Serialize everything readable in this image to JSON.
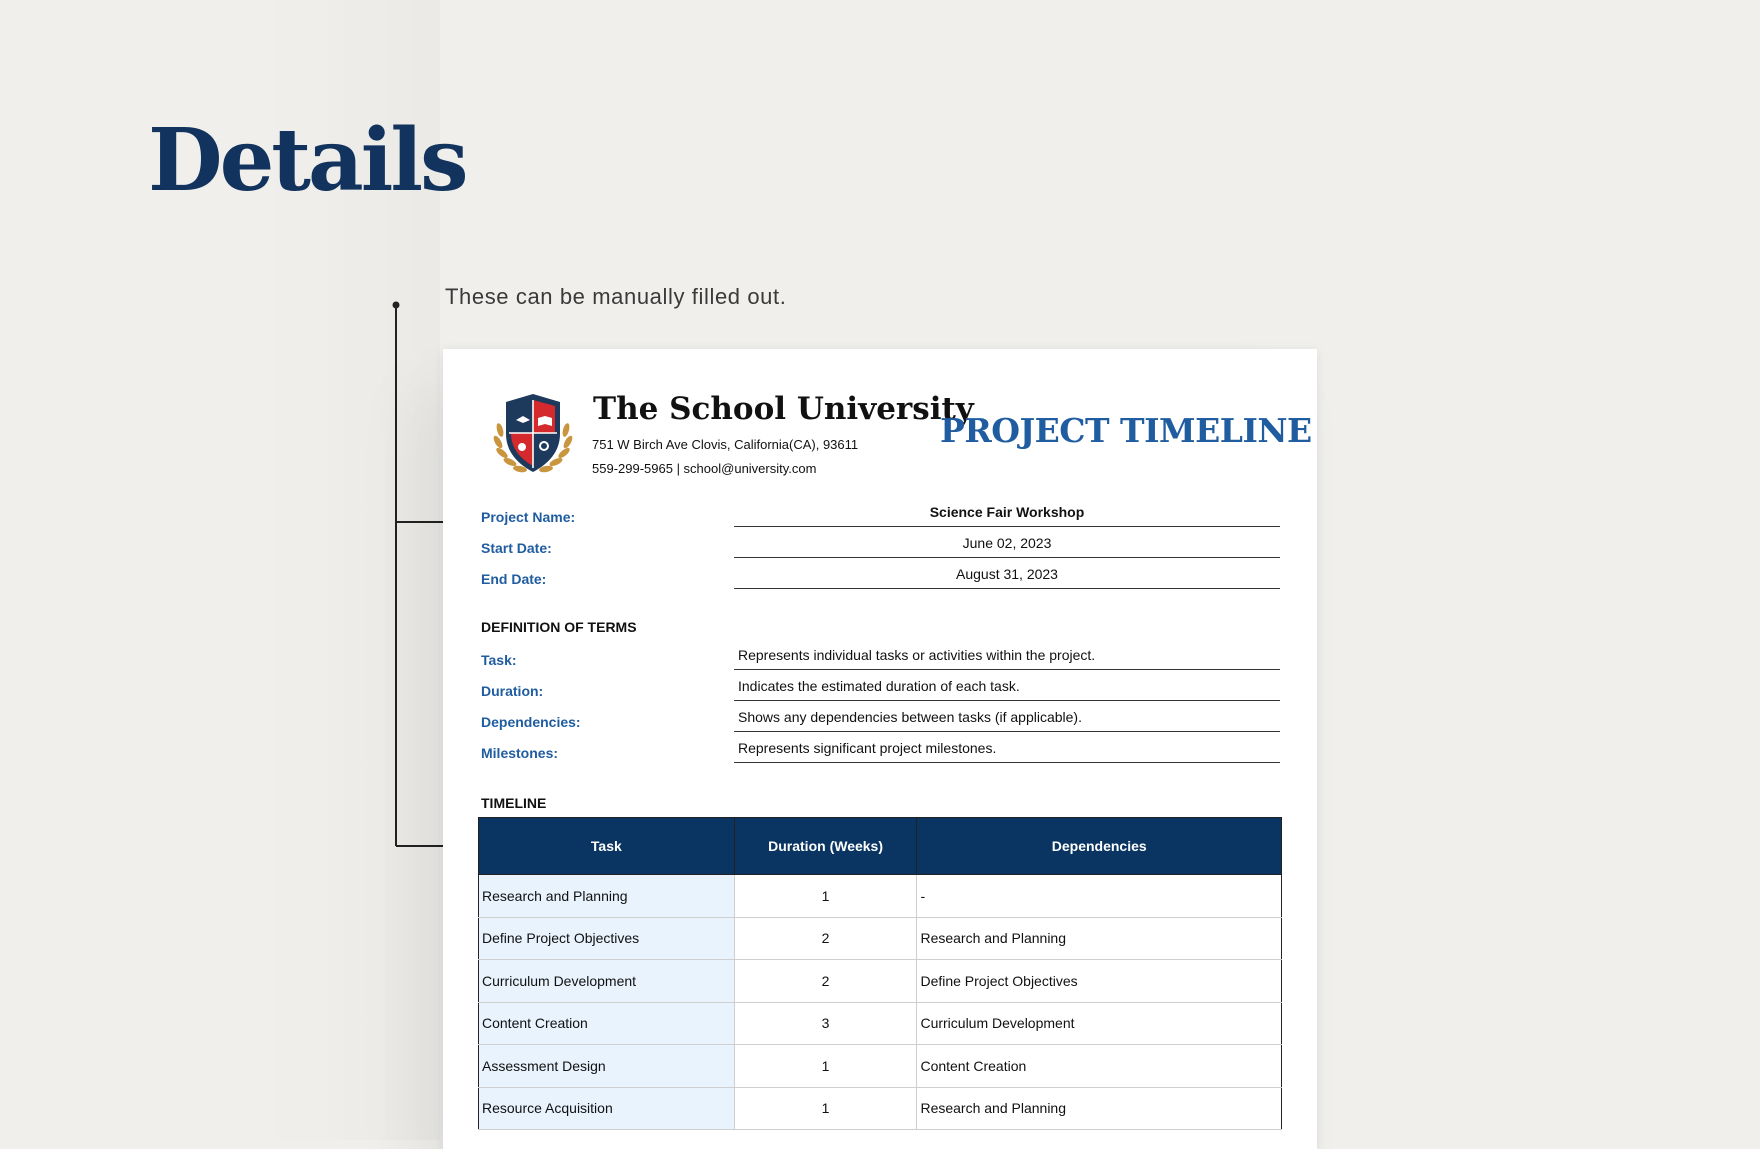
{
  "page": {
    "heading": "Details",
    "caption": "These can be manually filled out."
  },
  "document": {
    "school_name": "The School University",
    "address": "751 W Birch Ave Clovis, California(CA), 93611",
    "contact": "559-299-5965 | school@university.com",
    "title": "PROJECT TIMELINE",
    "details": [
      {
        "label": "Project Name:",
        "value": "Science Fair Workshop"
      },
      {
        "label": "Start Date:",
        "value": "June 02, 2023"
      },
      {
        "label": "End Date:",
        "value": "August 31, 2023"
      }
    ],
    "definitions_title": "DEFINITION OF TERMS",
    "definitions": [
      {
        "label": "Task:",
        "value": "Represents individual tasks or activities within the project."
      },
      {
        "label": "Duration:",
        "value": "Indicates the estimated duration of each task."
      },
      {
        "label": "Dependencies:",
        "value": "Shows any dependencies between tasks (if applicable)."
      },
      {
        "label": "Milestones:",
        "value": "Represents significant project milestones."
      }
    ],
    "timeline_title": "TIMELINE",
    "timeline": {
      "headers": [
        "Task",
        "Duration (Weeks)",
        "Dependencies"
      ],
      "rows": [
        [
          "Research and Planning",
          "1",
          "-"
        ],
        [
          "Define Project Objectives",
          "2",
          "Research and Planning"
        ],
        [
          "Curriculum Development",
          "2",
          "Define Project Objectives"
        ],
        [
          "Content Creation",
          "3",
          "Curriculum Development"
        ],
        [
          "Assessment Design",
          "1",
          "Content Creation"
        ],
        [
          "Resource Acquisition",
          "1",
          "Research and Planning"
        ]
      ]
    }
  },
  "colors": {
    "heading": "#11335e",
    "accent_blue": "#1f5da0",
    "table_header": "#0a3461",
    "task_cell": "#e8f3fd",
    "shield_red": "#d42a2e",
    "shield_navy": "#1d3a5c",
    "laurel_gold": "#c9953f"
  }
}
